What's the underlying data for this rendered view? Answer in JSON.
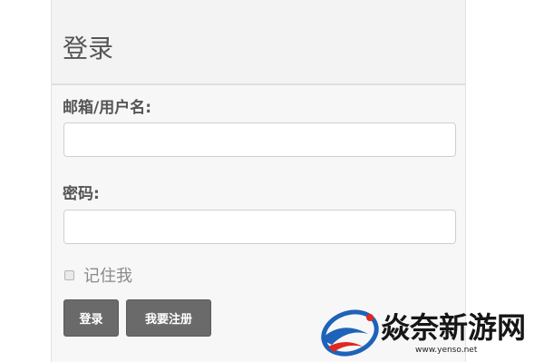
{
  "login": {
    "title": "登录",
    "username_label": "邮箱/用户名:",
    "username_value": "",
    "password_label": "密码:",
    "password_value": "",
    "remember_label": "记住我",
    "remember_checked": false,
    "login_button": "登录",
    "register_button": "我要注册"
  },
  "watermark": {
    "brand": "焱奈新游网",
    "url": "www.yenso.net",
    "colors": {
      "blue": "#1e63b8",
      "red": "#e0281e"
    }
  }
}
